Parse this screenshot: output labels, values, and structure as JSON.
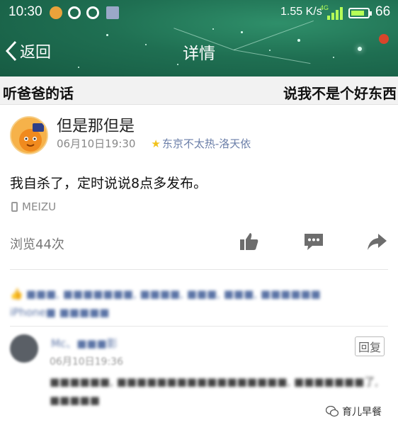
{
  "status_bar": {
    "time": "10:30",
    "net_speed": "1.55 K/s",
    "network_type": "4G",
    "battery_level": "66"
  },
  "nav": {
    "back_label": "返回",
    "title": "详情"
  },
  "banner": {
    "left_text": "听爸爸的话",
    "right_text": "说我不是个好东西"
  },
  "post": {
    "username": "但是那但是",
    "date": "06月10日19:30",
    "source": "东京不太热-洛天依",
    "content": "我自杀了，定时说说8点多发布。",
    "device": "MEIZU",
    "views": "浏览44次"
  },
  "likes": {
    "line1": "■■■, ■■■■■■■, ■■■■, ■■■, ■■■, ■■■■■■",
    "line2": "iPhone■ ■■■■■"
  },
  "comment": {
    "name": "Mc、■■■影",
    "time": "06月10日19:36",
    "text": "■■■■■■, ■■■■■■■■■■■■■■■■■, ■■■■■■■了, ■■■■■",
    "reply_label": "回复"
  },
  "watermark": {
    "text": "育儿早餐"
  },
  "colors": {
    "header_green": "#1f6f52",
    "link_blue": "#5b74a6",
    "avatar_orange": "#f39a2b",
    "signal_green": "#b6ff57"
  },
  "icons": [
    "back-chevron-icon",
    "like-icon",
    "comment-icon",
    "share-icon",
    "phone-icon",
    "star-icon",
    "wechat-icon"
  ]
}
